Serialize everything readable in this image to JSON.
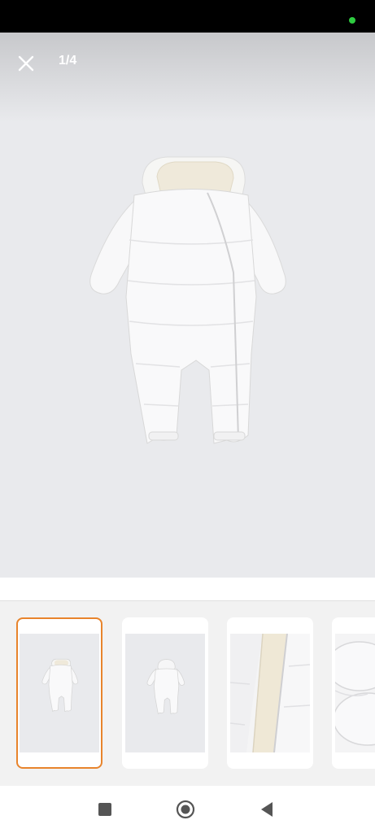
{
  "viewer": {
    "counter": "1/4",
    "close_icon": "close-icon",
    "product_image": "white-padded-baby-snowsuit-front"
  },
  "thumbnails": {
    "selected_index": 0,
    "items": [
      {
        "image": "snowsuit-front",
        "selected": true
      },
      {
        "image": "snowsuit-back",
        "selected": false
      },
      {
        "image": "snowsuit-zipper-detail",
        "selected": false
      },
      {
        "image": "snowsuit-cuff-detail",
        "selected": false
      }
    ]
  },
  "navigation": {
    "recents_icon": "square-icon",
    "home_icon": "circle-home-icon",
    "back_icon": "triangle-back-icon"
  },
  "colors": {
    "accent": "#e8842c",
    "viewer_background": "#e9eaed",
    "status_dot": "#2ecc40"
  }
}
